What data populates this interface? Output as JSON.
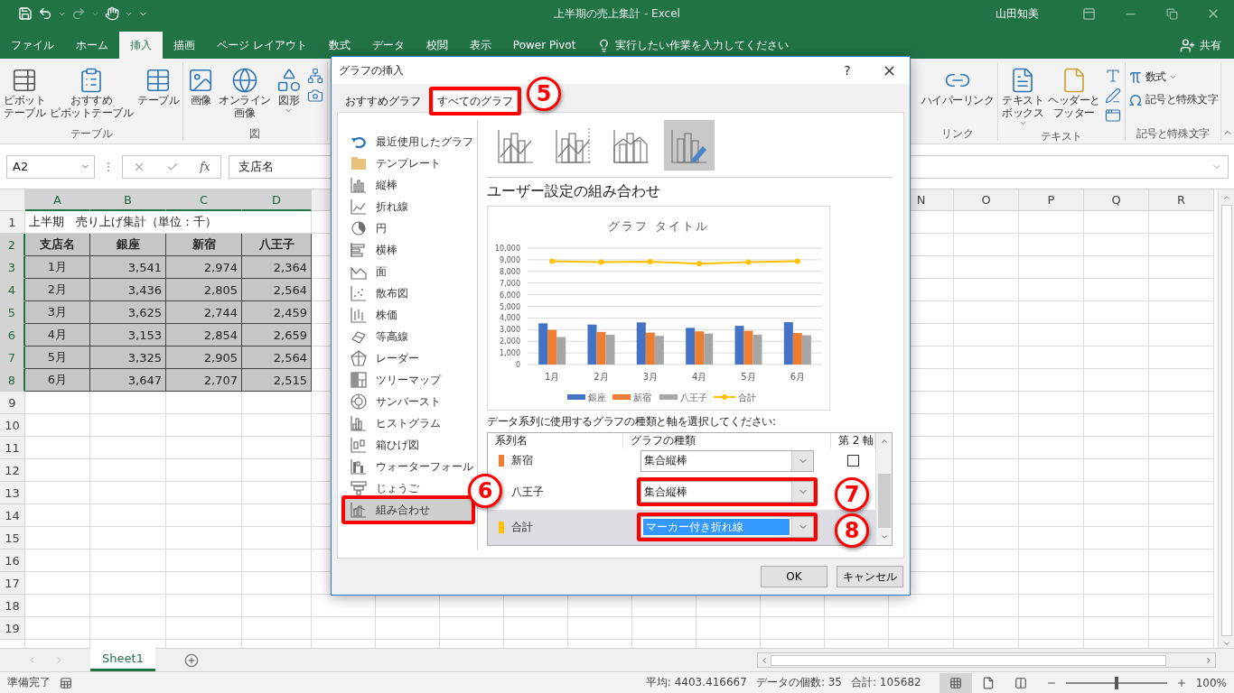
{
  "title_bar": {
    "document_title": "上半期の売上集計  -  Excel",
    "user": "山田知美"
  },
  "ribbon_tabs": [
    {
      "label": "ファイル",
      "selected": false
    },
    {
      "label": "ホーム",
      "selected": false
    },
    {
      "label": "挿入",
      "selected": true
    },
    {
      "label": "描画",
      "selected": false
    },
    {
      "label": "ページ レイアウト",
      "selected": false
    },
    {
      "label": "数式",
      "selected": false
    },
    {
      "label": "データ",
      "selected": false
    },
    {
      "label": "校閲",
      "selected": false
    },
    {
      "label": "表示",
      "selected": false
    },
    {
      "label": "Power Pivot",
      "selected": false
    }
  ],
  "tell_me": "実行したい作業を入力してください",
  "share": "共有",
  "ribbon_left": [
    {
      "label": "テーブル",
      "buttons": [
        {
          "kind": "large",
          "label": [
            "ピボット",
            "テーブル"
          ]
        },
        {
          "kind": "large",
          "label": [
            "おすすめ",
            "ピボットテーブル"
          ]
        },
        {
          "kind": "large",
          "label": [
            "テーブル"
          ]
        }
      ]
    },
    {
      "label": "図",
      "buttons": [
        {
          "kind": "large",
          "label": [
            "画像"
          ]
        },
        {
          "kind": "large",
          "label": [
            "オンライン",
            "画像"
          ]
        },
        {
          "kind": "large",
          "label": [
            "図形"
          ],
          "dropdown": true
        },
        {
          "kind": "stack"
        }
      ]
    }
  ],
  "ribbon_right": [
    {
      "label": "リンク",
      "buttons": [
        {
          "kind": "large",
          "label": [
            "ハイパーリンク"
          ]
        }
      ]
    },
    {
      "label": "テキスト",
      "buttons": [
        {
          "kind": "large",
          "label": [
            "テキスト",
            "ボックス"
          ],
          "dropdown": true
        },
        {
          "kind": "large",
          "label": [
            "ヘッダーと",
            "フッター"
          ]
        },
        {
          "kind": "stack"
        }
      ]
    },
    {
      "label": "記号と特殊文字",
      "buttons": [
        {
          "kind": "small",
          "label": "数式",
          "dropdown": true
        },
        {
          "kind": "small",
          "label": "記号と特殊文字"
        }
      ]
    }
  ],
  "formula_bar": {
    "name_box": "A2",
    "function_label": "fx",
    "content": "支店名"
  },
  "grid": {
    "columns_left": [
      {
        "label": "A",
        "selected": true
      },
      {
        "label": "B",
        "selected": true
      },
      {
        "label": "C",
        "selected": true
      },
      {
        "label": "D",
        "selected": true
      }
    ],
    "columns_right": [
      {
        "label": "N",
        "selected": false
      },
      {
        "label": "O",
        "selected": false
      },
      {
        "label": "P",
        "selected": false
      },
      {
        "label": "Q",
        "selected": false
      },
      {
        "label": "R",
        "selected": false
      }
    ],
    "rows": [
      {
        "number": "1",
        "selected": false,
        "kind": "title",
        "cells": [
          "上半期　売り上げ集計（単位：千）"
        ]
      },
      {
        "number": "2",
        "selected": true,
        "kind": "header",
        "cells": [
          "支店名",
          "銀座",
          "新宿",
          "八王子"
        ]
      },
      {
        "number": "3",
        "selected": true,
        "kind": "data",
        "cells": [
          "1月",
          "3,541",
          "2,974",
          "2,364"
        ]
      },
      {
        "number": "4",
        "selected": true,
        "kind": "data",
        "cells": [
          "2月",
          "3,436",
          "2,805",
          "2,564"
        ]
      },
      {
        "number": "5",
        "selected": true,
        "kind": "data",
        "cells": [
          "3月",
          "3,625",
          "2,744",
          "2,459"
        ]
      },
      {
        "number": "6",
        "selected": true,
        "kind": "data",
        "cells": [
          "4月",
          "3,153",
          "2,854",
          "2,659"
        ]
      },
      {
        "number": "7",
        "selected": true,
        "kind": "data",
        "cells": [
          "5月",
          "3,325",
          "2,905",
          "2,564"
        ]
      },
      {
        "number": "8",
        "selected": true,
        "kind": "data",
        "cells": [
          "6月",
          "3,647",
          "2,707",
          "2,515"
        ]
      },
      {
        "number": "9",
        "selected": false,
        "kind": "empty"
      },
      {
        "number": "10",
        "selected": false,
        "kind": "empty"
      },
      {
        "number": "11",
        "selected": false,
        "kind": "empty"
      },
      {
        "number": "12",
        "selected": false,
        "kind": "empty"
      },
      {
        "number": "13",
        "selected": false,
        "kind": "empty"
      },
      {
        "number": "14",
        "selected": false,
        "kind": "empty"
      },
      {
        "number": "15",
        "selected": false,
        "kind": "empty"
      },
      {
        "number": "16",
        "selected": false,
        "kind": "empty"
      },
      {
        "number": "17",
        "selected": false,
        "kind": "empty"
      },
      {
        "number": "18",
        "selected": false,
        "kind": "empty"
      },
      {
        "number": "19",
        "selected": false,
        "kind": "empty"
      }
    ]
  },
  "sheet_tabs": [
    {
      "label": "Sheet1",
      "selected": true
    }
  ],
  "status_bar": {
    "ready": "準備完了",
    "average": "平均: 4403.416667",
    "count": "データの個数: 35",
    "sum": "合計: 105682",
    "views": [
      {
        "selected": true
      },
      {
        "selected": false
      },
      {
        "selected": false
      }
    ],
    "zoom": {
      "level": 0.5,
      "label": "100%"
    }
  },
  "dialog": {
    "title": "グラフの挿入",
    "help": "?",
    "tabs": [
      {
        "label": "おすすめグラフ",
        "selected": false,
        "highlighted": false
      },
      {
        "label": "すべてのグラフ",
        "selected": true,
        "highlighted": true
      }
    ],
    "chart_types": [
      {
        "label": "最近使用したグラフ",
        "selected": false,
        "highlighted": false
      },
      {
        "label": "テンプレート",
        "selected": false,
        "highlighted": false
      },
      {
        "label": "縦棒",
        "selected": false,
        "highlighted": false
      },
      {
        "label": "折れ線",
        "selected": false,
        "highlighted": false
      },
      {
        "label": "円",
        "selected": false,
        "highlighted": false
      },
      {
        "label": "横棒",
        "selected": false,
        "highlighted": false
      },
      {
        "label": "面",
        "selected": false,
        "highlighted": false
      },
      {
        "label": "散布図",
        "selected": false,
        "highlighted": false
      },
      {
        "label": "株価",
        "selected": false,
        "highlighted": false
      },
      {
        "label": "等高線",
        "selected": false,
        "highlighted": false
      },
      {
        "label": "レーダー",
        "selected": false,
        "highlighted": false
      },
      {
        "label": "ツリーマップ",
        "selected": false,
        "highlighted": false
      },
      {
        "label": "サンバースト",
        "selected": false,
        "highlighted": false
      },
      {
        "label": "ヒストグラム",
        "selected": false,
        "highlighted": false
      },
      {
        "label": "箱ひげ図",
        "selected": false,
        "highlighted": false
      },
      {
        "label": "ウォーターフォール",
        "selected": false,
        "highlighted": false
      },
      {
        "label": "じょうご",
        "selected": false,
        "highlighted": false
      },
      {
        "label": "組み合わせ",
        "selected": true,
        "highlighted": true
      }
    ],
    "subtypes": [
      {
        "selected": false
      },
      {
        "selected": false
      },
      {
        "selected": false
      },
      {
        "selected": true
      }
    ],
    "heading": "ユーザー設定の組み合わせ",
    "chart_data": {
      "type": "bar",
      "title": "グラフ タイトル",
      "categories": [
        "1月",
        "2月",
        "3月",
        "4月",
        "5月",
        "6月"
      ],
      "stacked": false,
      "grid": true,
      "legend": "bottom",
      "series": [
        {
          "name": "銀座",
          "color": "#4472c4",
          "type": "bar",
          "values": [
            3541,
            3436,
            3625,
            3153,
            3325,
            3647
          ]
        },
        {
          "name": "新宿",
          "color": "#ed7d31",
          "type": "bar",
          "values": [
            2974,
            2805,
            2744,
            2854,
            2905,
            2707
          ]
        },
        {
          "name": "八王子",
          "color": "#a5a5a5",
          "type": "bar",
          "values": [
            2364,
            2564,
            2459,
            2659,
            2564,
            2515
          ]
        },
        {
          "name": "合計",
          "color": "#ffc000",
          "type": "line",
          "marker": true,
          "values": [
            8879,
            8805,
            8828,
            8666,
            8794,
            8869
          ]
        }
      ],
      "ylim": [
        0,
        10000
      ],
      "yticks": [
        {
          "value": 0,
          "label": "0"
        },
        {
          "value": 1000,
          "label": "1,000"
        },
        {
          "value": 2000,
          "label": "2,000"
        },
        {
          "value": 3000,
          "label": "3,000"
        },
        {
          "value": 4000,
          "label": "4,000"
        },
        {
          "value": 5000,
          "label": "5,000"
        },
        {
          "value": 6000,
          "label": "6,000"
        },
        {
          "value": 7000,
          "label": "7,000"
        },
        {
          "value": 8000,
          "label": "8,000"
        },
        {
          "value": 9000,
          "label": "9,000"
        },
        {
          "value": 10000,
          "label": "10,000"
        }
      ]
    },
    "series_prompt": "データ系列に使用するグラフの種類と軸を選択してください:",
    "series_columns": [
      "系列名",
      "グラフの種類",
      "第 2 軸"
    ],
    "series": [
      {
        "name": "新宿",
        "color": "#ed7d31",
        "chart_type": "集合縦棒",
        "secondary_axis": false,
        "selected": false,
        "highlighted": false
      },
      {
        "name": "八王子",
        "chart_type": "集合縦棒",
        "selected": false,
        "highlighted": true
      },
      {
        "name": "合計",
        "color": "#ffc000",
        "chart_type": "マーカー付き折れ線",
        "selected": true,
        "highlighted": true
      }
    ],
    "buttons": [
      "OK",
      "キャンセル"
    ],
    "callouts": [
      "5",
      "6",
      "7",
      "8"
    ]
  }
}
